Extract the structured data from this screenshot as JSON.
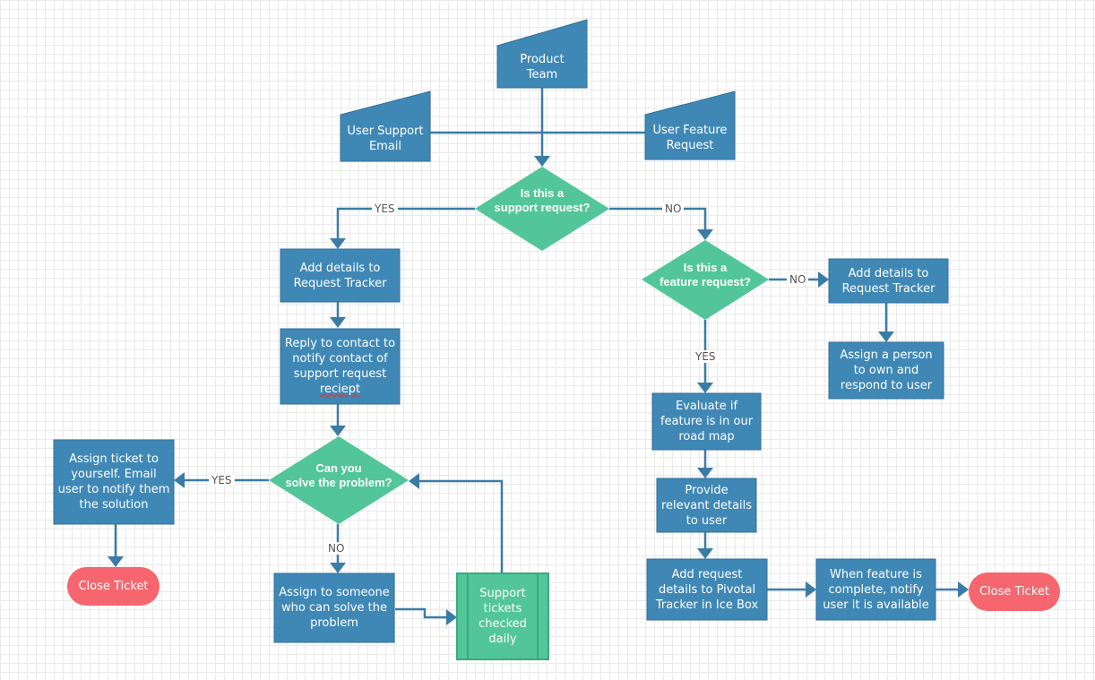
{
  "colors": {
    "process": "#3f88b6",
    "process_border": "#2f6f99",
    "decision": "#52c69a",
    "terminal": "#f6666f",
    "connector": "#3b7ca6"
  },
  "nodes": {
    "product_team": "Product Team",
    "user_support_email": "User Support Email",
    "user_feature_request": "User Feature Request",
    "support_decision": {
      "line1": "Is this a",
      "line2": "support  request?"
    },
    "add_details_left": "Add details to Request Tracker",
    "reply_contact": {
      "text": "Reply to contact to notify contact of support request",
      "misspelled": "reciept"
    },
    "solve_decision": {
      "line1": "Can you",
      "line2": "solve the  problem?"
    },
    "assign_self": "Assign ticket to yourself. Email user to notify them the solution",
    "close_ticket_left": "Close Ticket",
    "assign_someone": "Assign to someone who can solve the problem",
    "support_tickets_daily": "Support tickets checked daily",
    "feature_decision": {
      "line1": "Is this a",
      "line2": "feature  request?"
    },
    "add_details_right": "Add details to Request Tracker",
    "assign_person": "Assign a person to own and respond to user",
    "evaluate_roadmap": "Evaluate if feature is in our road map",
    "provide_details": "Provide relevant details to user",
    "add_pivotal": "Add request details to Pivotal Tracker in Ice Box",
    "notify_available": "When feature is complete, notify user it is available",
    "close_ticket_right": "Close Ticket"
  },
  "edge_labels": {
    "support_yes": "YES",
    "support_no": "NO",
    "feature_no": "NO",
    "feature_yes": "YES",
    "solve_yes": "YES",
    "solve_no": "NO"
  }
}
